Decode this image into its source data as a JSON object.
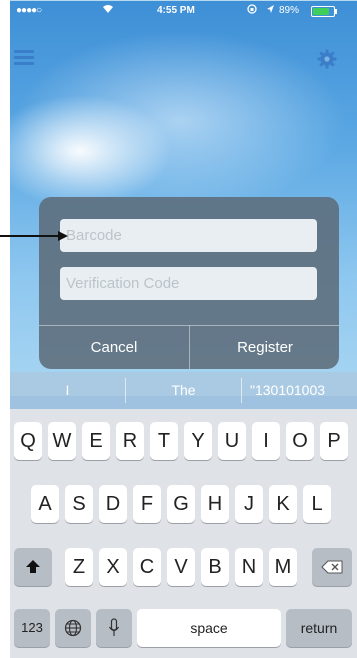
{
  "status_bar": {
    "signal": "●●●●○",
    "time": "4:55 PM",
    "battery_percent": "89%",
    "battery_level": 0.89
  },
  "nav": {
    "menu_icon": "hamburger-menu-icon",
    "settings_icon": "gear-icon"
  },
  "dialog": {
    "barcode_placeholder": "Barcode",
    "verification_placeholder": "Verification Code",
    "cancel_label": "Cancel",
    "register_label": "Register",
    "background": "#5c6c7a"
  },
  "suggestions": [
    "I",
    "The",
    "\"130101003"
  ],
  "keyboard": {
    "row1": [
      "Q",
      "W",
      "E",
      "R",
      "T",
      "Y",
      "U",
      "I",
      "O",
      "P"
    ],
    "row2": [
      "A",
      "S",
      "D",
      "F",
      "G",
      "H",
      "J",
      "K",
      "L"
    ],
    "row3": [
      "Z",
      "X",
      "C",
      "V",
      "B",
      "N",
      "M"
    ],
    "shift_icon": "shift-arrow-icon",
    "delete_icon": "backspace-icon",
    "numbers_label": "123",
    "globe_icon": "globe-icon",
    "mic_icon": "microphone-icon",
    "space_label": "space",
    "return_label": "return"
  },
  "colors": {
    "accent": "#3a7ec9",
    "sky_top": "#3e8fd6",
    "keyboard_bg": "#dfe3e8",
    "battery_fill": "#3fcf5a"
  }
}
